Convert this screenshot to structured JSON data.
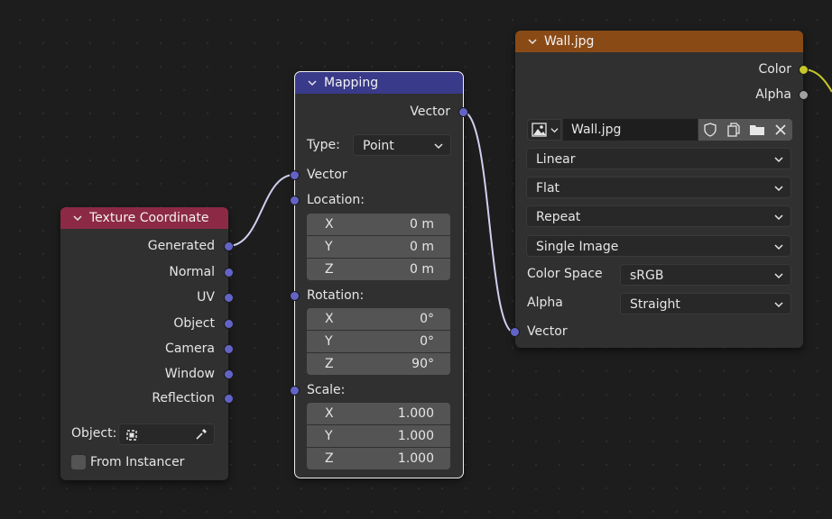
{
  "texture_coordinate": {
    "title": "Texture Coordinate",
    "outputs": [
      "Generated",
      "Normal",
      "UV",
      "Object",
      "Camera",
      "Window",
      "Reflection"
    ],
    "object_label": "Object:",
    "from_instancer_label": "From Instancer",
    "from_instancer_checked": false,
    "header_color": "#8c2a45"
  },
  "mapping": {
    "title": "Mapping",
    "output_label": "Vector",
    "type_label": "Type:",
    "type_value": "Point",
    "vector_label": "Vector",
    "location_label": "Location:",
    "location": [
      {
        "axis": "X",
        "value": "0 m"
      },
      {
        "axis": "Y",
        "value": "0 m"
      },
      {
        "axis": "Z",
        "value": "0 m"
      }
    ],
    "rotation_label": "Rotation:",
    "rotation": [
      {
        "axis": "X",
        "value": "0°"
      },
      {
        "axis": "Y",
        "value": "0°"
      },
      {
        "axis": "Z",
        "value": "90°"
      }
    ],
    "scale_label": "Scale:",
    "scale": [
      {
        "axis": "X",
        "value": "1.000"
      },
      {
        "axis": "Y",
        "value": "1.000"
      },
      {
        "axis": "Z",
        "value": "1.000"
      }
    ],
    "header_color": "#3a3a8a"
  },
  "image_texture": {
    "title": "Wall.jpg",
    "outputs": [
      "Color",
      "Alpha"
    ],
    "image_name": "Wall.jpg",
    "interpolation": "Linear",
    "projection": "Flat",
    "extension": "Repeat",
    "source": "Single Image",
    "color_space_label": "Color Space",
    "color_space_value": "sRGB",
    "alpha_label": "Alpha",
    "alpha_value": "Straight",
    "vector_label": "Vector",
    "header_color": "#8a4a16"
  },
  "colors": {
    "vector_socket": "#6363c7",
    "color_socket": "#c7c729",
    "float_socket": "#a1a1a1",
    "wire": "#c8c8e6"
  }
}
